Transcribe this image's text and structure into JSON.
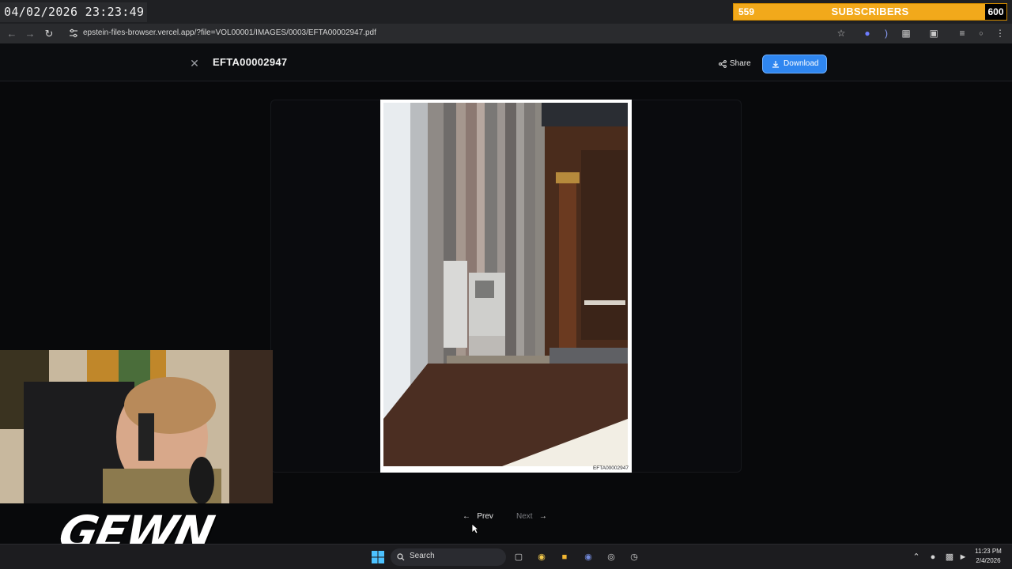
{
  "overlay": {
    "clock": "04/02/2026 23:23:49",
    "subscriber_current": "559",
    "subscriber_label": "SUBSCRIBERS",
    "subscriber_goal": "600",
    "subscriber_progress": 0.932
  },
  "browser": {
    "url": "epstein-files-browser.vercel.app/?file=VOL00001/IMAGES/0003/EFTA00002947.pdf"
  },
  "header": {
    "title": "EFTA00002947",
    "share_label": "Share",
    "download_label": "Download"
  },
  "document": {
    "bates_number": "EFTA00002947"
  },
  "pager": {
    "prev_label": "Prev",
    "next_label": "Next"
  },
  "stream": {
    "brand": "GEWN"
  },
  "taskbar": {
    "search_label": "Search",
    "time": "11:23 PM",
    "date": "2/4/2026"
  },
  "colors": {
    "accent": "#2f86f0",
    "subscriber_bar": "#f2a91b",
    "background": "#0a0b0d"
  },
  "icons": [
    "back-icon",
    "forward-icon",
    "reload-icon",
    "site-info-icon",
    "star-icon",
    "extensions-icon",
    "menu-icon",
    "close-icon",
    "share-icon",
    "download-icon",
    "arrow-left-icon",
    "arrow-right-icon",
    "windows-start-icon",
    "search-icon"
  ]
}
